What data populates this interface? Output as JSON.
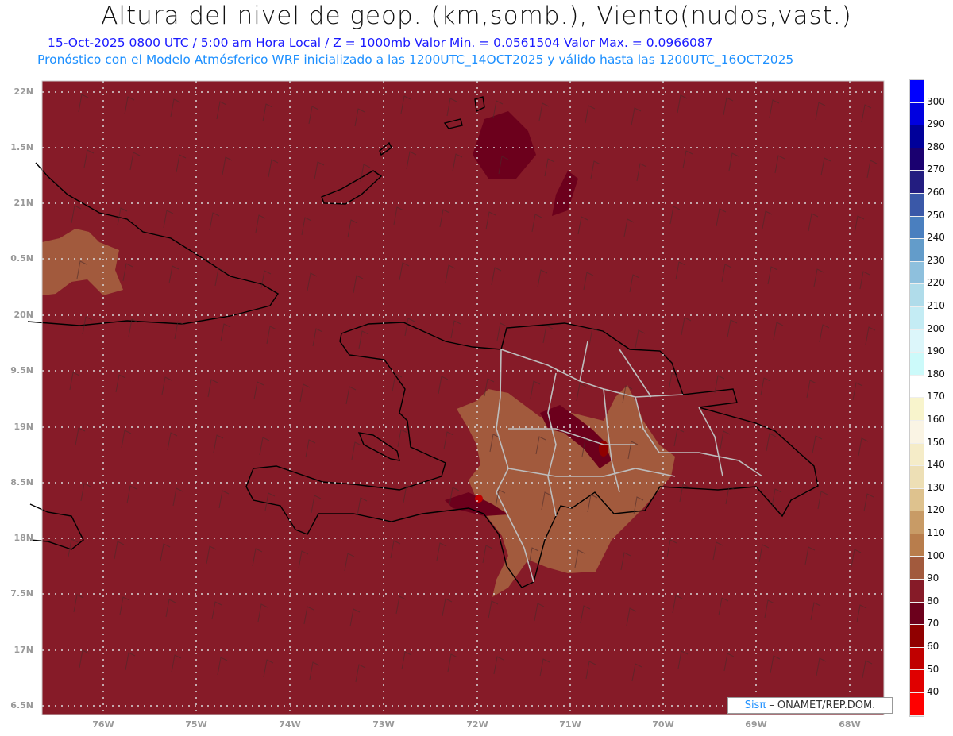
{
  "header": {
    "title": "Altura del nivel de geop. (km,somb.), Viento(nudos,vast.)",
    "subtitle": "15-Oct-2025  0800 UTC / 5:00 am Hora Local / Z = 1000mb Valor Min. = 0.0561504   Valor Max. = 0.0966087",
    "forecast_note": "Pronóstico con el Modelo Atmósferico WRF inicializado a las 1200UTC_14OCT2025 y válido hasta las  1200UTC_16OCT2025"
  },
  "map": {
    "lat_labels": [
      "22N",
      "1.5N",
      "21N",
      "0.5N",
      "20N",
      "9.5N",
      "19N",
      "8.5N",
      "18N",
      "7.5N",
      "17N",
      "6.5N"
    ],
    "lon_labels": [
      "76W",
      "75W",
      "74W",
      "73W",
      "72W",
      "71W",
      "70W",
      "69W",
      "68W"
    ],
    "colors": {
      "background": "#861b28",
      "shade_100": "#a25a3d",
      "shade_70": "#6c001c",
      "shade_60": "#900000",
      "grid": "#d8d8d8"
    }
  },
  "colorbar": {
    "labels": [
      "300",
      "290",
      "280",
      "270",
      "260",
      "250",
      "240",
      "230",
      "220",
      "210",
      "200",
      "190",
      "180",
      "170",
      "160",
      "150",
      "140",
      "130",
      "120",
      "110",
      "100",
      "90",
      "80",
      "70",
      "60",
      "50",
      "40"
    ],
    "colors": [
      "#0000ff",
      "#0000e0",
      "#00009a",
      "#1a0070",
      "#231d80",
      "#3a58a8",
      "#4a7fbf",
      "#639cca",
      "#8ec0dd",
      "#b0dcea",
      "#c4ecf4",
      "#dcf6fa",
      "#ccfafa",
      "#ffffff",
      "#f8f4cc",
      "#faf4e4",
      "#f5ecc8",
      "#eddfb5",
      "#dec28e",
      "#c89b66",
      "#b87d4c",
      "#a25a3d",
      "#861b28",
      "#6c001c",
      "#900000",
      "#c00000",
      "#e00000",
      "#ff0000"
    ]
  },
  "credit": {
    "brand": "Sisπ",
    "text": " –  ONAMET/REP.DOM."
  }
}
